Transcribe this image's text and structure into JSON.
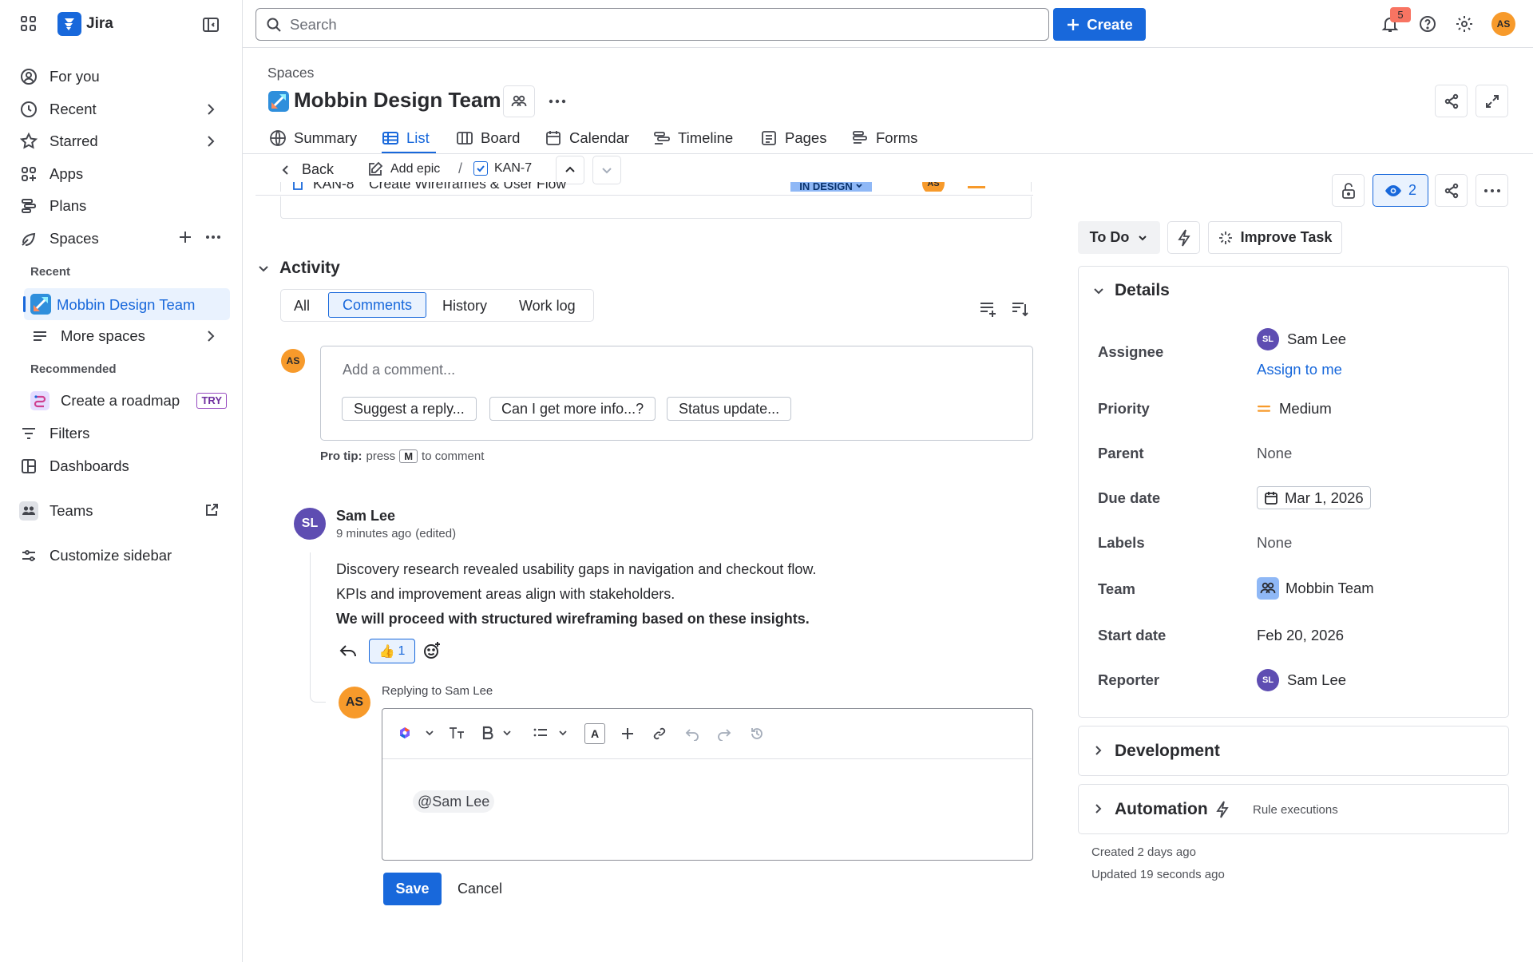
{
  "app": {
    "name": "Jira"
  },
  "sidebar": {
    "items": [
      {
        "label": "For you"
      },
      {
        "label": "Recent"
      },
      {
        "label": "Starred"
      },
      {
        "label": "Apps"
      },
      {
        "label": "Plans"
      },
      {
        "label": "Spaces"
      }
    ],
    "recent_heading": "Recent",
    "recent_space": "Mobbin Design Team",
    "more_spaces": "More spaces",
    "recommended_heading": "Recommended",
    "roadmap": "Create a roadmap",
    "try_badge": "TRY",
    "filters": "Filters",
    "dashboards": "Dashboards",
    "teams": "Teams",
    "customize": "Customize sidebar"
  },
  "topbar": {
    "search_placeholder": "Search",
    "create_label": "Create",
    "notification_count": "5",
    "user_initials": "AS",
    "accent": "#1868db"
  },
  "header": {
    "breadcrumb": "Spaces",
    "title": "Mobbin Design Team",
    "tabs": [
      "Summary",
      "List",
      "Board",
      "Calendar",
      "Timeline",
      "Pages",
      "Forms"
    ]
  },
  "subnav": {
    "back": "Back",
    "add_epic": "Add epic",
    "separator": "/",
    "issue_key": "KAN-7"
  },
  "child_item": {
    "key": "KAN-8",
    "summary": "Create Wireframes & User Flow",
    "status": "IN DESIGN",
    "assignee_initials": "AS"
  },
  "activity": {
    "title": "Activity",
    "tabs": [
      "All",
      "Comments",
      "History",
      "Work log"
    ],
    "comment_placeholder": "Add a comment...",
    "suggestions": [
      "Suggest a reply...",
      "Can I get more info...?",
      "Status update..."
    ],
    "pro_tip_label": "Pro tip:",
    "pro_tip_press": "press",
    "pro_tip_key": "M",
    "pro_tip_rest": "to comment",
    "current_user_initials": "AS"
  },
  "comment": {
    "author": "Sam Lee",
    "author_initials": "SL",
    "time": "9 minutes ago",
    "edited": "(edited)",
    "lines": [
      "Discovery research revealed usability gaps in navigation and checkout flow.",
      "KPIs and improvement areas align with stakeholders."
    ],
    "bold_line": "We will proceed with structured wireframing based on these insights.",
    "reaction_emoji": "👍",
    "reaction_count": "1"
  },
  "reply": {
    "replying_to": "Replying to Sam Lee",
    "user_initials": "AS",
    "mention": "@Sam Lee",
    "save": "Save",
    "cancel": "Cancel"
  },
  "right_panel": {
    "watchers": "2",
    "status": "To Do",
    "improve": "Improve Task",
    "details_title": "Details",
    "labels": {
      "assignee": "Assignee",
      "priority": "Priority",
      "parent": "Parent",
      "due": "Due date",
      "labels": "Labels",
      "team": "Team",
      "start": "Start date",
      "reporter": "Reporter"
    },
    "values": {
      "assignee": "Sam Lee",
      "assignee_initials": "SL",
      "assign_to_me": "Assign to me",
      "priority": "Medium",
      "parent": "None",
      "due": "Mar 1, 2026",
      "labels": "None",
      "team": "Mobbin Team",
      "start": "Feb 20, 2026",
      "reporter": "Sam Lee",
      "reporter_initials": "SL"
    },
    "development": "Development",
    "automation": "Automation",
    "rule_executions": "Rule executions",
    "created": "Created 2 days ago",
    "updated": "Updated 19 seconds ago"
  }
}
